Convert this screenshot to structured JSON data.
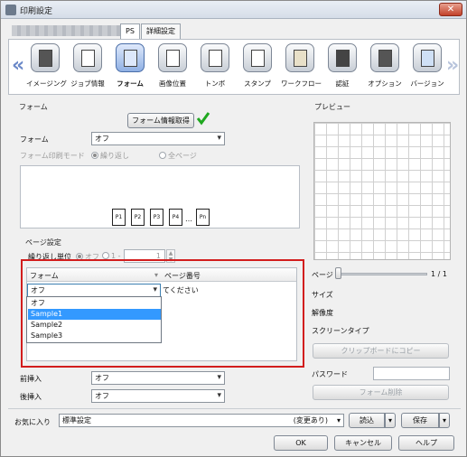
{
  "window": {
    "title": "印刷設定",
    "close_label": "✕"
  },
  "tabs": {
    "model_name": "",
    "tab1": "PS",
    "tab2": "詳細設定"
  },
  "toolbar": {
    "items": [
      {
        "label": "イメージング",
        "icon": "imaging-icon"
      },
      {
        "label": "ジョブ情報",
        "icon": "job-info-icon"
      },
      {
        "label": "フォーム",
        "icon": "form-icon"
      },
      {
        "label": "画像位置",
        "icon": "image-position-icon"
      },
      {
        "label": "トンボ",
        "icon": "crop-marks-icon"
      },
      {
        "label": "スタンプ",
        "icon": "stamp-icon"
      },
      {
        "label": "ワークフロー",
        "icon": "workflow-icon"
      },
      {
        "label": "認証",
        "icon": "auth-icon"
      },
      {
        "label": "オプション",
        "icon": "option-icon"
      },
      {
        "label": "バージョン",
        "icon": "version-icon"
      }
    ],
    "left_arrow": "«",
    "right_arrow": "»",
    "active_index": 2
  },
  "form_section": {
    "group_title": "フォーム",
    "get_info_button": "フォーム情報取得",
    "form_label": "フォーム",
    "form_value": "オフ",
    "print_mode_label": "フォーム印刷モード",
    "mode_repeat": "繰り返し",
    "mode_all_pages": "全ページ",
    "pages": [
      "P1",
      "P2",
      "P3",
      "P4",
      "…",
      "Pn"
    ]
  },
  "page_settings": {
    "title": "ページ設定",
    "repeat_unit_label": "繰り返し単位",
    "opt_off": "オフ",
    "opt_1": "1 -",
    "value": "1",
    "col_form": "フォーム",
    "col_page_number": "ページ番号",
    "cell_value": "オフ",
    "cell_hint": "てください",
    "dropdown_options": [
      "オフ",
      "Sample1",
      "Sample2",
      "Sample3"
    ],
    "selected_option": 1
  },
  "insert": {
    "front_label": "前挿入",
    "front_value": "オフ",
    "back_label": "後挿入",
    "back_value": "オフ"
  },
  "preview": {
    "title": "プレビュー",
    "page_label": "ページ",
    "page_value": "1 / 1",
    "size_label": "サイズ",
    "resolution_label": "解像度",
    "screen_type_label": "スクリーンタイプ",
    "copy_button": "クリップボードにコピー",
    "password_label": "パスワード",
    "delete_form_button": "フォーム削除"
  },
  "favorites": {
    "label": "お気に入り",
    "value": "標準設定",
    "changed_note": "(変更あり)",
    "load_button": "読込",
    "save_button": "保存"
  },
  "dialog": {
    "ok": "OK",
    "cancel": "キャンセル",
    "help": "ヘルプ"
  },
  "colors": {
    "accent": "#3399ff",
    "highlight_border": "#d21d1d",
    "checkmark": "#1fa81f"
  }
}
